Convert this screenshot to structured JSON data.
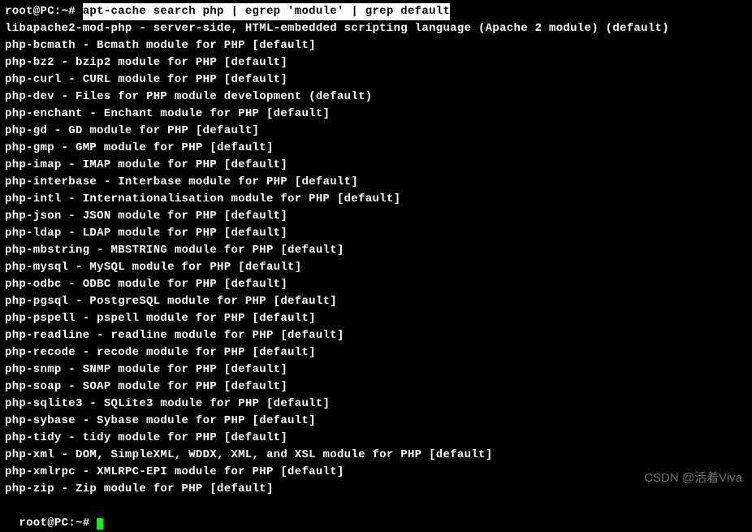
{
  "prompt": "root@PC:~# ",
  "command": "apt-cache search php | egrep 'module' | grep default",
  "output_lines": [
    "libapache2-mod-php - server-side, HTML-embedded scripting language (Apache 2 module) (default)",
    "php-bcmath - Bcmath module for PHP [default]",
    "php-bz2 - bzip2 module for PHP [default]",
    "php-curl - CURL module for PHP [default]",
    "php-dev - Files for PHP module development (default)",
    "php-enchant - Enchant module for PHP [default]",
    "php-gd - GD module for PHP [default]",
    "php-gmp - GMP module for PHP [default]",
    "php-imap - IMAP module for PHP [default]",
    "php-interbase - Interbase module for PHP [default]",
    "php-intl - Internationalisation module for PHP [default]",
    "php-json - JSON module for PHP [default]",
    "php-ldap - LDAP module for PHP [default]",
    "php-mbstring - MBSTRING module for PHP [default]",
    "php-mysql - MySQL module for PHP [default]",
    "php-odbc - ODBC module for PHP [default]",
    "php-pgsql - PostgreSQL module for PHP [default]",
    "php-pspell - pspell module for PHP [default]",
    "php-readline - readline module for PHP [default]",
    "php-recode - recode module for PHP [default]",
    "php-snmp - SNMP module for PHP [default]",
    "php-soap - SOAP module for PHP [default]",
    "php-sqlite3 - SQLite3 module for PHP [default]",
    "php-sybase - Sybase module for PHP [default]",
    "php-tidy - tidy module for PHP [default]",
    "php-xml - DOM, SimpleXML, WDDX, XML, and XSL module for PHP [default]",
    "php-xmlrpc - XMLRPC-EPI module for PHP [default]",
    "php-zip - Zip module for PHP [default]"
  ],
  "next_prompt_partial": "root@PC:~# ",
  "watermark": "CSDN @活着Viva"
}
